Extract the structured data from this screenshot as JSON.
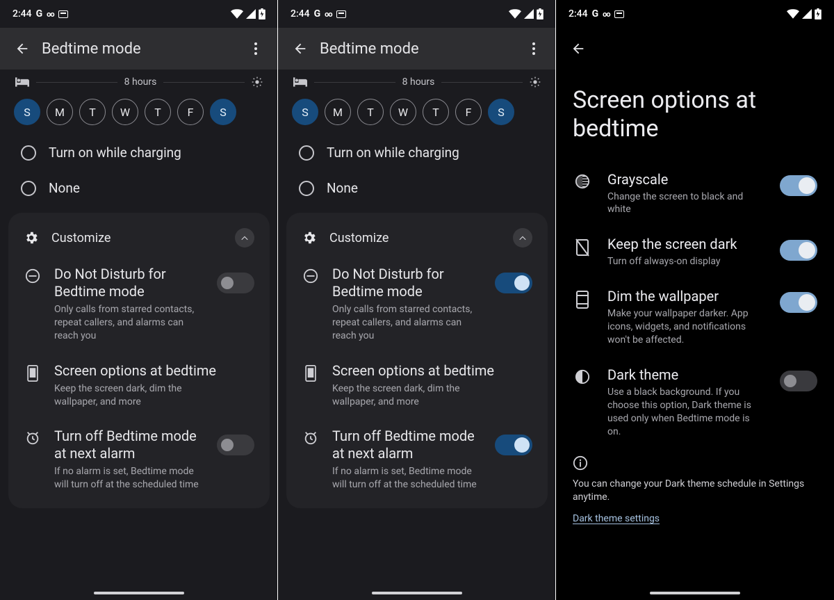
{
  "status": {
    "time": "2:44",
    "g": "G",
    "vm": "oo"
  },
  "pane1": {
    "title": "Bedtime mode",
    "duration": "8 hours",
    "days": [
      "S",
      "M",
      "T",
      "W",
      "T",
      "F",
      "S"
    ],
    "days_selected": [
      true,
      false,
      false,
      false,
      false,
      false,
      true
    ],
    "radios": {
      "charging": "Turn on while charging",
      "none": "None"
    },
    "customize": {
      "label": "Customize",
      "dnd": {
        "title": "Do Not Disturb for Bedtime mode",
        "desc": "Only calls from starred contacts, repeat callers, and alarms can reach you",
        "on": false
      },
      "screen": {
        "title": "Screen options at bedtime",
        "desc": "Keep the screen dark, dim the wallpaper, and more"
      },
      "alarm": {
        "title": "Turn off Bedtime mode at next alarm",
        "desc": "If no alarm is set, Bedtime mode will turn off at the scheduled time",
        "on": false
      }
    }
  },
  "pane2": {
    "title": "Bedtime mode",
    "duration": "8 hours",
    "days": [
      "S",
      "M",
      "T",
      "W",
      "T",
      "F",
      "S"
    ],
    "days_selected": [
      true,
      false,
      false,
      false,
      false,
      false,
      true
    ],
    "radios": {
      "charging": "Turn on while charging",
      "none": "None"
    },
    "customize": {
      "label": "Customize",
      "dnd": {
        "title": "Do Not Disturb for Bedtime mode",
        "desc": "Only calls from starred contacts, repeat callers, and alarms can reach you",
        "on": true
      },
      "screen": {
        "title": "Screen options at bedtime",
        "desc": "Keep the screen dark, dim the wallpaper, and more"
      },
      "alarm": {
        "title": "Turn off Bedtime mode at next alarm",
        "desc": "If no alarm is set, Bedtime mode will turn off at the scheduled time",
        "on": true
      }
    }
  },
  "pane3": {
    "title": "Screen options at bedtime",
    "grayscale": {
      "title": "Grayscale",
      "desc": "Change the screen to black and white",
      "on": true
    },
    "keepdark": {
      "title": "Keep the screen dark",
      "desc": "Turn off always-on display",
      "on": true
    },
    "dimwall": {
      "title": "Dim the wallpaper",
      "desc": "Make your wallpaper darker. App icons, widgets, and notifications won't be affected.",
      "on": true
    },
    "darktheme": {
      "title": "Dark theme",
      "desc": "Use a black background. If you choose this option, Dark theme is used only when Bedtime mode is on.",
      "on": false
    },
    "info": "You can change your Dark theme schedule in Settings anytime.",
    "link": "Dark theme settings"
  }
}
